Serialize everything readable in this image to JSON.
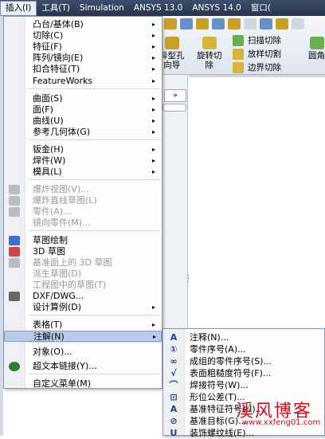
{
  "menubar": {
    "items": [
      {
        "label": "插入(I)",
        "active": true
      },
      {
        "label": "工具(T)"
      },
      {
        "label": "Simulation"
      },
      {
        "label": "ANSYS 13.0"
      },
      {
        "label": "ANSYS 14.0"
      },
      {
        "label": "窗口("
      }
    ]
  },
  "toolbar": {
    "hole_wizard": "异型孔\n向导",
    "revolved_cut": "旋转切\n除",
    "swept_cut": "扫描切除",
    "lofted_cut": "放样切割",
    "boundary_cut": "边界切除",
    "fillet": "圆角"
  },
  "feature_manager": {
    "collapse_label": "»"
  },
  "insert_menu": {
    "items": [
      {
        "label": "凸台/基体(B)",
        "arrow": true
      },
      {
        "label": "切除(C)",
        "arrow": true
      },
      {
        "label": "特征(F)",
        "arrow": true
      },
      {
        "label": "阵列/镜向(E)",
        "arrow": true
      },
      {
        "label": "扣合特征(T)",
        "arrow": true
      },
      {
        "label": "FeatureWorks",
        "arrow": true
      },
      {
        "label": "曲面(S)",
        "arrow": true
      },
      {
        "label": "面(F)",
        "arrow": true
      },
      {
        "label": "曲线(U)",
        "arrow": true
      },
      {
        "label": "参考几何体(G)",
        "arrow": true
      },
      {
        "label": "钣金(H)",
        "arrow": true
      },
      {
        "label": "焊件(W)",
        "arrow": true
      },
      {
        "label": "模具(L)",
        "arrow": true
      },
      {
        "label": "爆炸视图(V)...",
        "disabled": true,
        "icon": "explode-view-icon"
      },
      {
        "label": "爆炸直线草图(L)",
        "disabled": true,
        "icon": "explode-line-sketch-icon"
      },
      {
        "label": "零件(A)...",
        "disabled": true,
        "icon": "part-icon"
      },
      {
        "label": "镜向零件(M)...",
        "disabled": true
      },
      {
        "label": "草图绘制",
        "icon": "sketch-icon"
      },
      {
        "label": "3D 草图",
        "icon": "3d-sketch-icon"
      },
      {
        "label": "基准面上的 3D 草图",
        "disabled": true,
        "icon": "3d-sketch-on-plane-icon"
      },
      {
        "label": "派生草图(D)",
        "disabled": true
      },
      {
        "label": "工程图中的草图(T)",
        "disabled": true
      },
      {
        "label": "DXF/DWG...",
        "icon": "dxf-icon"
      },
      {
        "label": "设计算例(D)",
        "arrow": true
      },
      {
        "label": "表格(T)",
        "arrow": true
      },
      {
        "label": "注解(N)",
        "arrow": true,
        "highlighted": true
      },
      {
        "label": "对象(O)..."
      },
      {
        "label": "超文本链接(Y)...",
        "icon": "hyperlink-globe-icon"
      },
      {
        "label": "自定义菜单(M)"
      }
    ]
  },
  "annotations_submenu": {
    "items": [
      {
        "label": "注释(N)...",
        "icon": "note-icon",
        "glyph": "A"
      },
      {
        "label": "零件序号(A)...",
        "icon": "balloon-icon",
        "glyph": "①"
      },
      {
        "label": "成组的零件序号(S)...",
        "icon": "stacked-balloon-icon",
        "glyph": "∞"
      },
      {
        "label": "表面粗糙度符号(F)...",
        "icon": "surface-finish-icon",
        "glyph": "√"
      },
      {
        "label": "焊接符号(W)...",
        "icon": "weld-symbol-icon",
        "glyph": "⌒"
      },
      {
        "label": "形位公差(T)...",
        "icon": "gtol-icon",
        "glyph": "⊡"
      },
      {
        "label": "基准特征符号(U)...",
        "icon": "datum-feature-icon",
        "glyph": "A"
      },
      {
        "label": "基准目标(G)...",
        "icon": "datum-target-icon",
        "glyph": "⊘"
      },
      {
        "label": "装饰螺纹线(E)...",
        "icon": "cosmetic-thread-icon",
        "glyph": "U"
      }
    ]
  },
  "watermark": {
    "title": "溪风博客",
    "url": "www.xxfeng01.com"
  },
  "colors": {
    "menubar": "#2f3e5c",
    "highlight": "#b8cbe9",
    "watermark": "#c8121b"
  }
}
